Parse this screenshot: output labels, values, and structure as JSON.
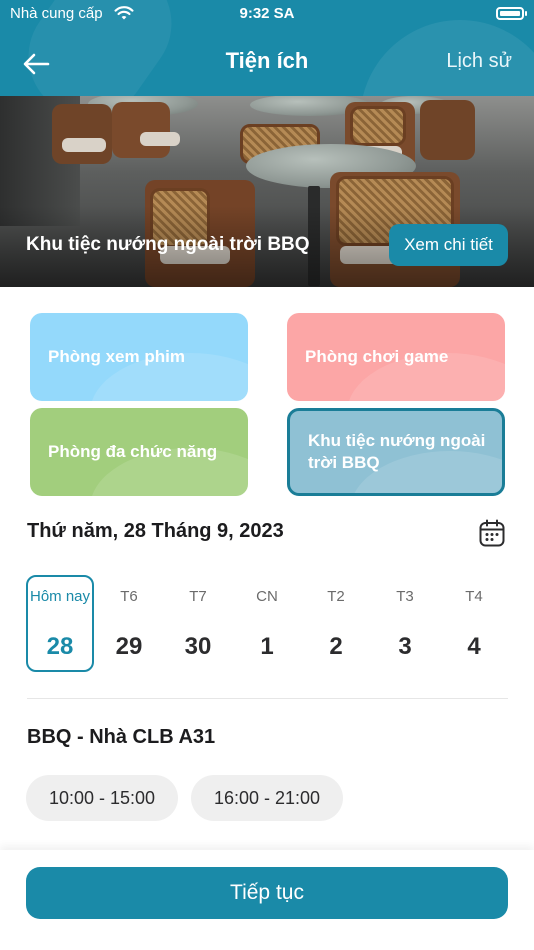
{
  "status_bar": {
    "carrier": "Nhà cung cấp",
    "time": "9:32 SA"
  },
  "nav": {
    "title": "Tiện ích",
    "history_label": "Lịch sử"
  },
  "hero": {
    "title": "Khu tiệc nướng ngoài trời BBQ",
    "detail_button": "Xem chi tiết"
  },
  "facilities": [
    {
      "label": "Phòng xem phim",
      "color": "#94d9fb",
      "selected": false
    },
    {
      "label": "Phòng chơi game",
      "color": "#fca6a6",
      "selected": false
    },
    {
      "label": "Phòng đa chức năng",
      "color": "#a2ce7d",
      "selected": false
    },
    {
      "label": "Khu tiệc nướng ngoài trời BBQ",
      "color": "#8fc1d4",
      "selected": true
    }
  ],
  "date_heading": "Thứ năm, 28 Tháng 9, 2023",
  "days": [
    {
      "name": "Hôm nay",
      "num": "28",
      "selected": true
    },
    {
      "name": "T6",
      "num": "29",
      "selected": false
    },
    {
      "name": "T7",
      "num": "30",
      "selected": false
    },
    {
      "name": "CN",
      "num": "1",
      "selected": false
    },
    {
      "name": "T2",
      "num": "2",
      "selected": false
    },
    {
      "name": "T3",
      "num": "3",
      "selected": false
    },
    {
      "name": "T4",
      "num": "4",
      "selected": false
    }
  ],
  "venue": {
    "title": "BBQ - Nhà CLB A31",
    "slots": [
      "10:00 - 15:00",
      "16:00 - 21:00"
    ]
  },
  "continue_button": "Tiếp tục",
  "colors": {
    "primary": "#1a8aa8"
  }
}
